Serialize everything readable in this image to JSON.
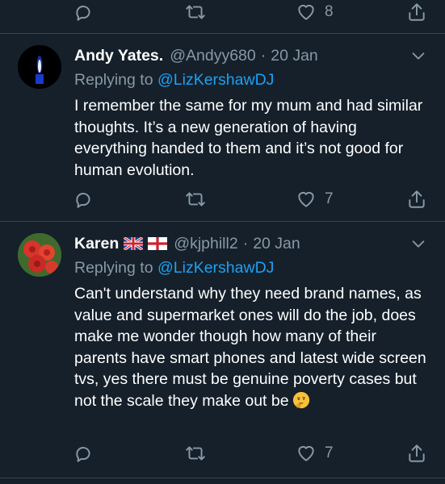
{
  "top_actions": {
    "like_count": "8"
  },
  "tweets": [
    {
      "name": "Andy Yates.",
      "handle": "@Andyy680",
      "separator": "·",
      "date": "20 Jan",
      "replying_prefix": "Replying to",
      "replying_to": "@LizKershawDJ",
      "text": "I remember the same for my mum and had similar thoughts. It’s a new generation of having everything handed to them and it’s not good for human evolution.",
      "like_count": "7",
      "avatar": "candle-avatar"
    },
    {
      "name": "Karen",
      "handle": "@kjphill2",
      "separator": "·",
      "date": "20 Jan",
      "replying_prefix": "Replying to",
      "replying_to": "@LizKershawDJ",
      "text": "Can't understand why they need brand names, as value and supermarket ones will do the job, does make me wonder though how many of their parents have smart phones and latest wide screen tvs, yes there must be genuine poverty cases but not the scale they make out be",
      "emoji": "thinking-face-emoji",
      "like_count": "7",
      "avatar": "red-roses-avatar"
    }
  ],
  "colors": {
    "background": "#15202b",
    "divider": "#38444d",
    "muted": "#8899a6",
    "link": "#1da1f2",
    "text": "#ffffff"
  }
}
